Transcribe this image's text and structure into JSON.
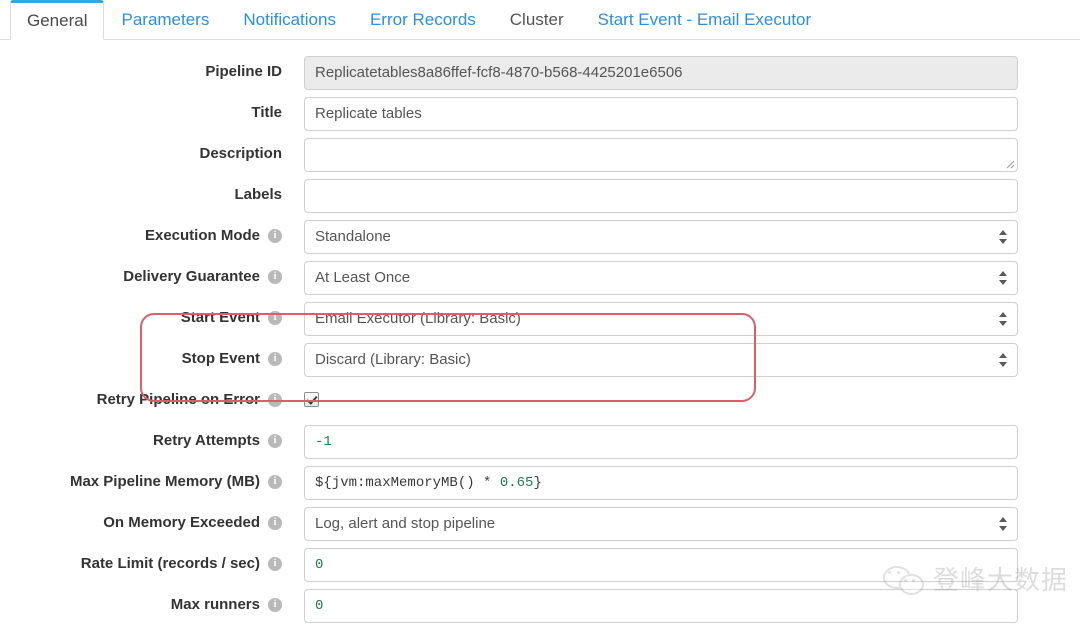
{
  "tabs": [
    {
      "label": "General",
      "active": true,
      "style": "active"
    },
    {
      "label": "Parameters",
      "active": false,
      "style": "link"
    },
    {
      "label": "Notifications",
      "active": false,
      "style": "link"
    },
    {
      "label": "Error Records",
      "active": false,
      "style": "link"
    },
    {
      "label": "Cluster",
      "active": false,
      "style": "muted"
    },
    {
      "label": "Start Event - Email Executor",
      "active": false,
      "style": "link"
    }
  ],
  "form": {
    "pipeline_id": {
      "label": "Pipeline ID",
      "value": "Replicatetables8a86ffef-fcf8-4870-b568-4425201e6506"
    },
    "title": {
      "label": "Title",
      "value": "Replicate tables"
    },
    "description": {
      "label": "Description",
      "value": ""
    },
    "labels": {
      "label": "Labels",
      "value": ""
    },
    "execution_mode": {
      "label": "Execution Mode",
      "value": "Standalone",
      "info": "i"
    },
    "delivery_guarantee": {
      "label": "Delivery Guarantee",
      "value": "At Least Once",
      "info": "i"
    },
    "start_event": {
      "label": "Start Event",
      "value": "Email Executor (Library: Basic)",
      "info": "i"
    },
    "stop_event": {
      "label": "Stop Event",
      "value": "Discard (Library: Basic)",
      "info": "i"
    },
    "retry_pipeline_on_error": {
      "label": "Retry Pipeline on Error",
      "checked": true,
      "info": "i"
    },
    "retry_attempts": {
      "label": "Retry Attempts",
      "value": "-1",
      "info": "i"
    },
    "max_pipeline_memory": {
      "label": "Max Pipeline Memory (MB)",
      "value_prefix": "${jvm:maxMemoryMB() * ",
      "value_number": "0.65",
      "value_suffix": "}",
      "info": "i"
    },
    "on_memory_exceeded": {
      "label": "On Memory Exceeded",
      "value": "Log, alert and stop pipeline",
      "info": "i"
    },
    "rate_limit": {
      "label": "Rate Limit (records / sec)",
      "value": "0",
      "info": "i"
    },
    "max_runners": {
      "label": "Max runners",
      "value": "0",
      "info": "i"
    }
  },
  "annotation": {
    "name": "start-stop-event-highlight",
    "color": "#d9606a"
  },
  "watermark": {
    "text": "登峰大数据"
  },
  "colors": {
    "tab_link": "#2e8ede",
    "tab_active_border": "#2eaae0",
    "label": "#333333",
    "field_text": "#555555",
    "mono_number": "#1f7a4d",
    "annotation": "#d9606a"
  }
}
